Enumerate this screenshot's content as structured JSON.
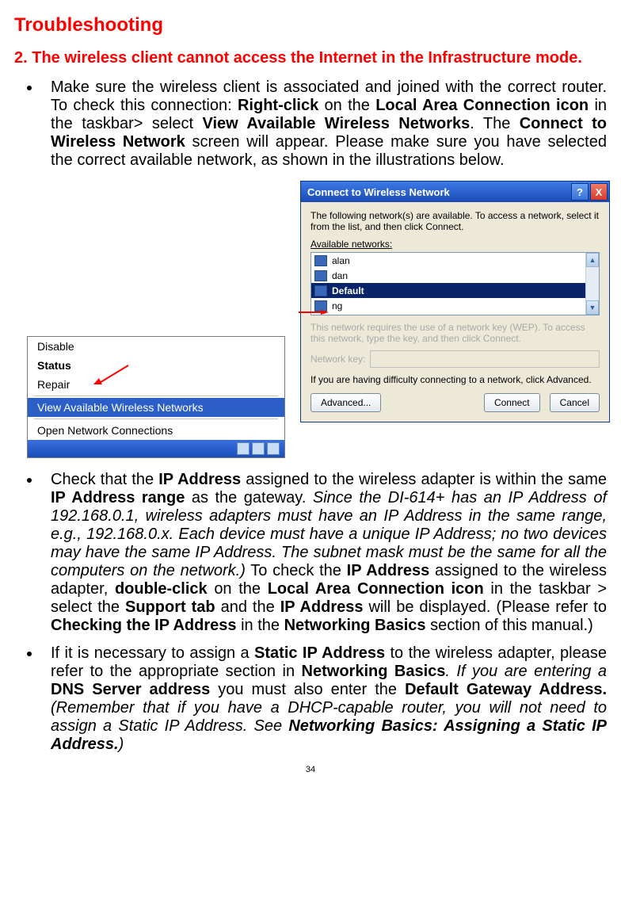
{
  "heading": "Troubleshooting",
  "subheading": "2. The wireless client cannot access the Internet in the Infrastructure mode.",
  "bullets": {
    "b1": {
      "t1": "Make sure the wireless client is associated and joined with the correct router.  To check this connection:  ",
      "rc": "Right-click",
      "t2": " on the ",
      "laci": "Local Area Connection icon",
      "t3": " in the taskbar> select ",
      "vawn": "View Available Wireless Networks",
      "t4": ".  The ",
      "ctwn": "Connect to Wireless Network",
      "t5": " screen will appear.  Please make sure you have selected the correct available network, as shown in the illustrations below."
    },
    "b2": {
      "t1": "Check that the ",
      "ipa": "IP Address",
      "t2": " assigned to the wireless adapter is within the same ",
      "ipar": "IP Address range",
      "t3": " as the gateway.  ",
      "it1": "Since the DI-614+ has an IP Address of 192.168.0.1, wireless adapters must have an IP Address in the same range, e.g., 192.168.0.x.  Each device must have a unique IP Address; no two devices may have the same IP Address. The subnet mask must be the same for all the computers on the network.)",
      "t4": "  To check the ",
      "ipa2": "IP Address",
      "t5": " assigned to the wireless adapter, ",
      "dc": "double-click",
      "t6": " on the ",
      "laci2": "Local Area Connection icon",
      "t7": " in the taskbar > select the ",
      "sup": "Support tab",
      "t8": " and the ",
      "ipa3": "IP Address",
      "t9": " will be displayed.  (Please refer to ",
      "ctip": "Checking the IP Address",
      "t10": " in the ",
      "nb": "Networking Basics",
      "t11": " section of this manual.)"
    },
    "b3": {
      "t1": "If it is necessary to assign a ",
      "sip": "Static IP Address",
      "t2": " to the wireless adapter, please refer to the appropriate section in ",
      "nb": "Networking Basics",
      "t3": ".  If you are entering a ",
      "dns": "DNS Server address",
      "t4": " you must also enter the ",
      "dga": "Default Gateway Address.",
      "t5": "  ",
      "it1": "(Remember that if you have a DHCP-capable router, you will not need to assign a Static IP Address. See  ",
      "itb": "Networking Basics: Assigning a Static IP Address.",
      "it2": ")"
    }
  },
  "ctx_menu": {
    "disable": "Disable",
    "status": "Status",
    "repair": "Repair",
    "view": "View Available Wireless Networks",
    "open": "Open Network Connections"
  },
  "dialog": {
    "title": "Connect to Wireless Network",
    "intro": "The following network(s) are available. To access a network, select it from the list, and then click Connect.",
    "av_label": "Available networks:",
    "networks": {
      "n1": "alan",
      "n2": "dan",
      "n3": "Default",
      "n4": "ng"
    },
    "wep": "This network requires the use of a network key (WEP). To access this network, type the key, and then click Connect.",
    "key_label": "Network key:",
    "trouble": "If you are having difficulty connecting to a network, click Advanced.",
    "advanced": "Advanced...",
    "connect": "Connect",
    "cancel": "Cancel"
  },
  "page_number": "34"
}
